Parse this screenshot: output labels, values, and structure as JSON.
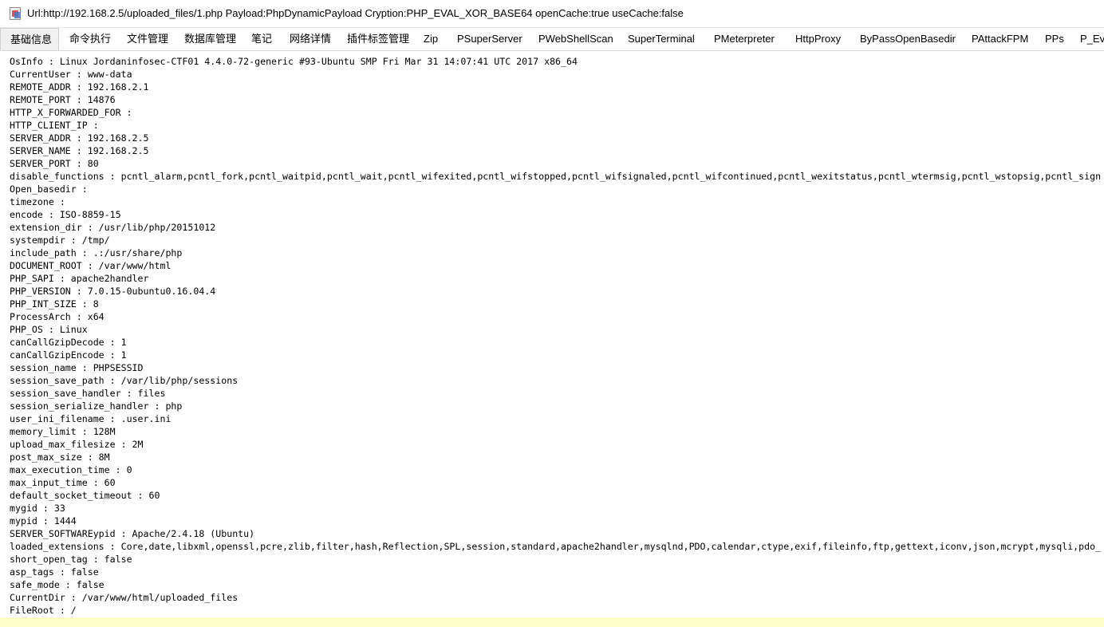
{
  "window": {
    "title": "Url:http://192.168.2.5/uploaded_files/1.php Payload:PhpDynamicPayload Cryption:PHP_EVAL_XOR_BASE64 openCache:true useCache:false",
    "icon": "java-app-icon"
  },
  "tabs": [
    {
      "label": "基础信息",
      "active": true
    },
    {
      "label": "命令执行",
      "active": false
    },
    {
      "label": "文件管理",
      "active": false
    },
    {
      "label": "数据库管理",
      "active": false
    },
    {
      "label": "笔记",
      "active": false
    },
    {
      "label": "网络详情",
      "active": false
    },
    {
      "label": "插件标签管理",
      "active": false
    },
    {
      "label": "Zip",
      "active": false
    },
    {
      "label": "PSuperServer",
      "active": false
    },
    {
      "label": "PWebShellScan",
      "active": false
    },
    {
      "label": "SuperTerminal",
      "active": false
    },
    {
      "label": "PMeterpreter",
      "active": false
    },
    {
      "label": "HttpProxy",
      "active": false
    },
    {
      "label": "ByPassOpenBasedir",
      "active": false
    },
    {
      "label": "PAttackFPM",
      "active": false
    },
    {
      "label": "PPs",
      "active": false
    },
    {
      "label": "P_Eva",
      "active": false
    }
  ],
  "info_lines": [
    "OsInfo : Linux Jordaninfosec-CTF01 4.4.0-72-generic #93-Ubuntu SMP Fri Mar 31 14:07:41 UTC 2017 x86_64",
    "CurrentUser : www-data",
    "REMOTE_ADDR : 192.168.2.1",
    "REMOTE_PORT : 14876",
    "HTTP_X_FORWARDED_FOR :",
    "HTTP_CLIENT_IP :",
    "SERVER_ADDR : 192.168.2.5",
    "SERVER_NAME : 192.168.2.5",
    "SERVER_PORT : 80",
    "disable_functions : pcntl_alarm,pcntl_fork,pcntl_waitpid,pcntl_wait,pcntl_wifexited,pcntl_wifstopped,pcntl_wifsignaled,pcntl_wifcontinued,pcntl_wexitstatus,pcntl_wtermsig,pcntl_wstopsig,pcntl_sign",
    "Open_basedir :",
    "timezone :",
    "encode : ISO-8859-15",
    "extension_dir : /usr/lib/php/20151012",
    "systempdir : /tmp/",
    "include_path : .:/usr/share/php",
    "DOCUMENT_ROOT : /var/www/html",
    "PHP_SAPI : apache2handler",
    "PHP_VERSION : 7.0.15-0ubuntu0.16.04.4",
    "PHP_INT_SIZE : 8",
    "ProcessArch : x64",
    "PHP_OS : Linux",
    "canCallGzipDecode : 1",
    "canCallGzipEncode : 1",
    "session_name : PHPSESSID",
    "session_save_path : /var/lib/php/sessions",
    "session_save_handler : files",
    "session_serialize_handler : php",
    "user_ini_filename : .user.ini",
    "memory_limit : 128M",
    "upload_max_filesize : 2M",
    "post_max_size : 8M",
    "max_execution_time : 0",
    "max_input_time : 60",
    "default_socket_timeout : 60",
    "mygid : 33",
    "mypid : 1444",
    "SERVER_SOFTWAREypid : Apache/2.4.18 (Ubuntu)",
    "loaded_extensions : Core,date,libxml,openssl,pcre,zlib,filter,hash,Reflection,SPL,session,standard,apache2handler,mysqlnd,PDO,calendar,ctype,exif,fileinfo,ftp,gettext,iconv,json,mcrypt,mysqli,pdo_",
    "short_open_tag : false",
    "asp_tags : false",
    "safe_mode : false",
    "CurrentDir : /var/www/html/uploaded_files",
    "FileRoot : /"
  ],
  "colors": {
    "current_line_highlight": "#ffffc8",
    "active_tab_bg": "#f0f0f0"
  }
}
